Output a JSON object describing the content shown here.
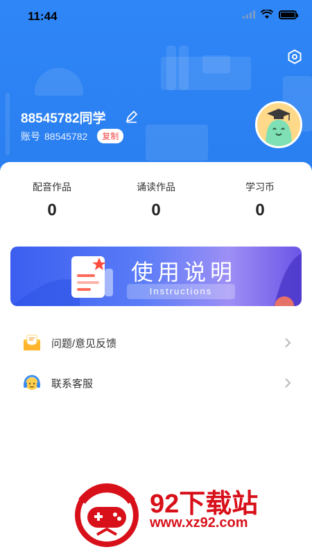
{
  "status_bar": {
    "time": "11:44"
  },
  "profile": {
    "name": "88545782同学",
    "account_label": "账号",
    "account_number": "88545782",
    "copy_label": "复制"
  },
  "stats": [
    {
      "label": "配音作品",
      "value": "0"
    },
    {
      "label": "诵读作品",
      "value": "0"
    },
    {
      "label": "学习币",
      "value": "0"
    }
  ],
  "banner": {
    "title": "使用说明",
    "subtitle": "Instructions"
  },
  "menu": [
    {
      "label": "问题/意见反馈",
      "icon": "feedback-envelope-icon"
    },
    {
      "label": "联系客服",
      "icon": "customer-service-headset-icon"
    }
  ],
  "watermark": {
    "title": "92下载站",
    "url": "www.xz92.com"
  },
  "colors": {
    "header_blue": "#2f86f6",
    "copy_red": "#f04a4a",
    "watermark_red": "#d8101a"
  }
}
